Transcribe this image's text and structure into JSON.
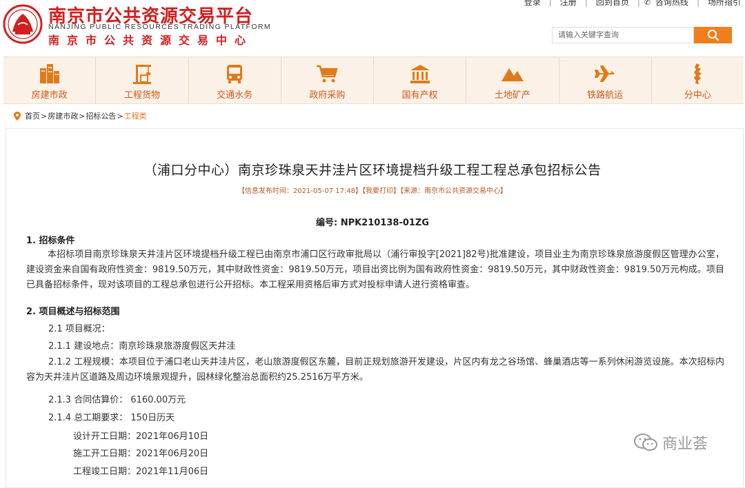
{
  "header": {
    "logo_cn": "南京市公共资源交易平台",
    "logo_en": "NANJING PUBLIC RESOURCES TRADING PLATFORM",
    "logo_sub": "南京市公共资源交易中心",
    "top_links": [
      "登录",
      "注册",
      "回到首页",
      "咨询热线",
      "场所指引"
    ],
    "search_placeholder": "请输入关键字查询"
  },
  "nav": {
    "items": [
      {
        "label": "房建市政",
        "icon": "building-icon"
      },
      {
        "label": "工程货物",
        "icon": "crane-icon"
      },
      {
        "label": "交通水务",
        "icon": "bus-icon"
      },
      {
        "label": "政府采购",
        "icon": "cart-icon"
      },
      {
        "label": "国有产权",
        "icon": "bank-icon"
      },
      {
        "label": "土地矿产",
        "icon": "mountain-icon"
      },
      {
        "label": "铁路航运",
        "icon": "plane-icon"
      },
      {
        "label": "分中心",
        "icon": "region-map-icon"
      }
    ]
  },
  "breadcrumb": [
    "首页",
    "房建市政",
    "招标公告",
    "工程类"
  ],
  "article": {
    "title": "（浦口分中心）南京珍珠泉天井洼片区环境提档升级工程工程总承包招标公告",
    "meta_time": "【信息发布时间：2021-05-07 17:48】",
    "meta_print": "【我要打印】",
    "meta_source": "【来源：南京市公共资源交易中心】",
    "code": "编号: NPK210138-01ZG",
    "section1": "1. 招标条件",
    "para1": "本招标项目南京珍珠泉天井洼片区环境提档升级工程已由南京市浦口区行政审批局以（浦行审投字[2021]82号)批准建设，项目业主为南京珍珠泉旅游度假区管理办公室，建设资金来自国有政府性资金：9819.50万元，其中财政性资金：9819.50万元，项目出资比例为国有政府性资金：9819.50万元，其中财政性资金：9819.50万元构成。项目已具备招标条件，现对该项目的工程总承包进行公开招标。本工程采用资格后审方式对投标申请人进行资格审查。",
    "section2": "2. 项目概述与招标范围",
    "l211": "2.1 项目概况：",
    "l2111": "2.1.1 建设地点：南京珍珠泉旅游度假区天井洼",
    "para212": "2.1.2 工程规模：本项目位于浦口老山天井洼片区，老山旅游度假区东麓，目前正规划旅游开发建设，片区内有龙之谷场馆、蜂巢酒店等一系列休闲游览设施。本次招标内容为天井洼片区道路及周边环境景观提升，园林绿化整治总面积约25.2516万平方米。",
    "l213": "2.1.3 合同估算价：  6160.00万元",
    "l214": "2.1.4 总工期要求：  150日历天",
    "design_start": "设计开工日期：2021年06月10日",
    "build_start": "施工开工日期：2021年06月20日",
    "finish": "工程竣工日期：2021年11月06日"
  },
  "watermark": "商业荟",
  "colors": {
    "brand_red": "#d21f1f",
    "accent_orange": "#f07e1c",
    "nav_bg": "#fbf1e6",
    "nav_text": "#d0581b"
  }
}
